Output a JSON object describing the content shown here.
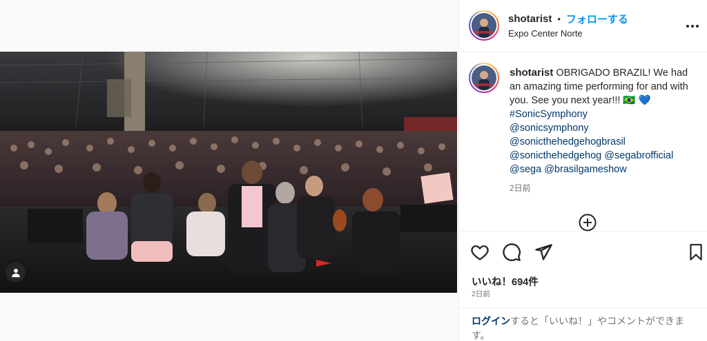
{
  "post": {
    "username": "shotarist",
    "separator": "•",
    "follow_label": "フォローする",
    "location": "Expo Center Norte"
  },
  "caption": {
    "username": "shotarist",
    "text": "OBRIGADO BRAZIL! We had an amazing time performing for and with you. See you next year!!! 🇧🇷 💙",
    "hashtag": "#SonicSymphony",
    "mentions": [
      "@sonicsymphony",
      "@sonicthehedgehogbrasil",
      "@sonicthehedgehog",
      "@segabrofficial",
      "@sega",
      "@brasilgameshow"
    ],
    "time": "2日前"
  },
  "stats": {
    "likes": "いいね！694件",
    "time": "2日前"
  },
  "login_prompt": {
    "link": "ログイン",
    "text": "すると「いいね！」やコメントができます。"
  },
  "icons": {
    "like": "heart-icon",
    "comment": "comment-icon",
    "share": "share-icon",
    "save": "bookmark-icon",
    "more": "more-icon",
    "tag": "user-tag-icon",
    "load_more": "plus-circle-icon"
  },
  "colors": {
    "accent": "#0095f6",
    "link": "#00376b",
    "muted": "#737373",
    "text": "#262626"
  }
}
